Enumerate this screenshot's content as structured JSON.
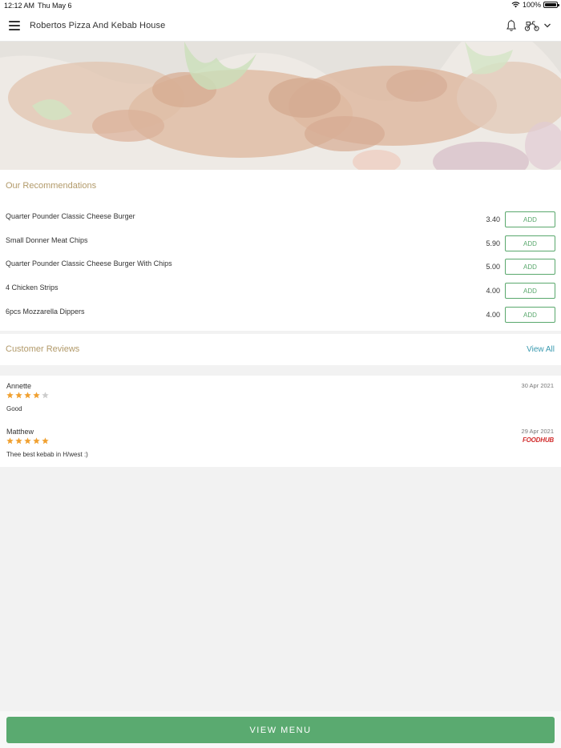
{
  "status_bar": {
    "time": "12:12 AM",
    "date": "Thu May 6",
    "battery": "100%"
  },
  "header": {
    "title": "Robertos Pizza And Kebab House",
    "icons": [
      "menu-icon",
      "bell-icon",
      "delivery-scooter-icon",
      "chevron-down-icon"
    ]
  },
  "recommendations": {
    "title": "Our Recommendations",
    "items": [
      {
        "name": "Quarter Pounder Classic Cheese Burger",
        "price": "3.40",
        "button": "ADD"
      },
      {
        "name": "Small Donner Meat Chips",
        "price": "5.90",
        "button": "ADD"
      },
      {
        "name": "Quarter Pounder Classic Cheese Burger With Chips",
        "price": "5.00",
        "button": "ADD"
      },
      {
        "name": "4 Chicken Strips",
        "price": "4.00",
        "button": "ADD"
      },
      {
        "name": "6pcs Mozzarella Dippers",
        "price": "4.00",
        "button": "ADD"
      }
    ]
  },
  "reviews": {
    "title": "Customer Reviews",
    "view_all": "View All",
    "items": [
      {
        "name": "Annette",
        "rating": 4,
        "max_rating": 5,
        "text": "Good",
        "date": "30 Apr 2021",
        "source": ""
      },
      {
        "name": "Matthew",
        "rating": 5,
        "max_rating": 5,
        "text": "Thee best kebab in H/west :)",
        "date": "29 Apr 2021",
        "source": "FOODHUB"
      }
    ]
  },
  "footer": {
    "button": "VIEW MENU"
  },
  "colors": {
    "accent_green": "#5aaa70",
    "section_title": "#b29a6a",
    "link": "#3a9ab0",
    "star": "#f0a030",
    "star_empty": "#cccccc",
    "foodhub_red": "#d22e2e"
  }
}
